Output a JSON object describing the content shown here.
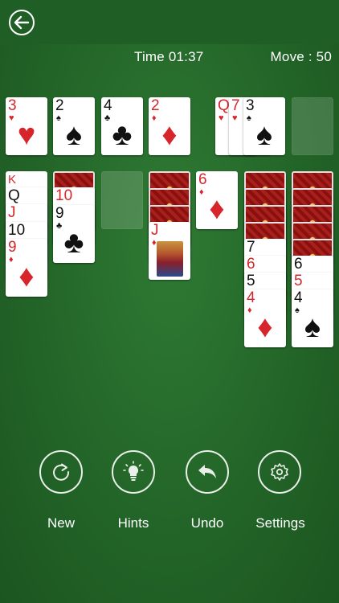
{
  "header": {
    "back_icon": "arrow-left-icon"
  },
  "status": {
    "time": "Time 01:37",
    "moves": "Move : 50"
  },
  "foundations": [
    {
      "rank": "3",
      "suit": "♥",
      "color": "red"
    },
    {
      "rank": "2",
      "suit": "♠",
      "color": "black"
    },
    {
      "rank": "4",
      "suit": "♣",
      "color": "black"
    },
    {
      "rank": "2",
      "suit": "♦",
      "color": "red"
    }
  ],
  "waste": [
    {
      "rank": "Q",
      "suit": "♥",
      "color": "red"
    },
    {
      "rank": "7",
      "suit": "♥",
      "color": "red"
    },
    {
      "rank": "3",
      "suit": "♠",
      "color": "black"
    }
  ],
  "tableau": {
    "col1": [
      {
        "rank": "K",
        "suit": "♥",
        "color": "red"
      },
      {
        "rank": "Q",
        "suit": "♠",
        "color": "black"
      },
      {
        "rank": "J",
        "suit": "♥",
        "color": "red"
      },
      {
        "rank": "10",
        "suit": "♠",
        "color": "black"
      },
      {
        "rank": "9",
        "suit": "♦",
        "color": "red"
      }
    ],
    "col2": [
      {
        "rank": "10",
        "suit": "♦",
        "color": "red"
      },
      {
        "rank": "9",
        "suit": "♣",
        "color": "black"
      }
    ],
    "col4": [
      {
        "rank": "J",
        "suit": "♦",
        "color": "red"
      }
    ],
    "col5": [
      {
        "rank": "6",
        "suit": "♦",
        "color": "red"
      }
    ],
    "col6": [
      {
        "rank": "7",
        "suit": "♠",
        "color": "black"
      },
      {
        "rank": "6",
        "suit": "♦",
        "color": "red"
      },
      {
        "rank": "5",
        "suit": "♠",
        "color": "black"
      },
      {
        "rank": "4",
        "suit": "♦",
        "color": "red"
      }
    ],
    "col7": [
      {
        "rank": "6",
        "suit": "♣",
        "color": "black"
      },
      {
        "rank": "5",
        "suit": "♦",
        "color": "red"
      },
      {
        "rank": "4",
        "suit": "♠",
        "color": "black"
      }
    ]
  },
  "controls": [
    {
      "label": "New",
      "icon": "refresh-icon"
    },
    {
      "label": "Hints",
      "icon": "lightbulb-icon"
    },
    {
      "label": "Undo",
      "icon": "undo-icon"
    },
    {
      "label": "Settings",
      "icon": "gear-icon"
    }
  ]
}
